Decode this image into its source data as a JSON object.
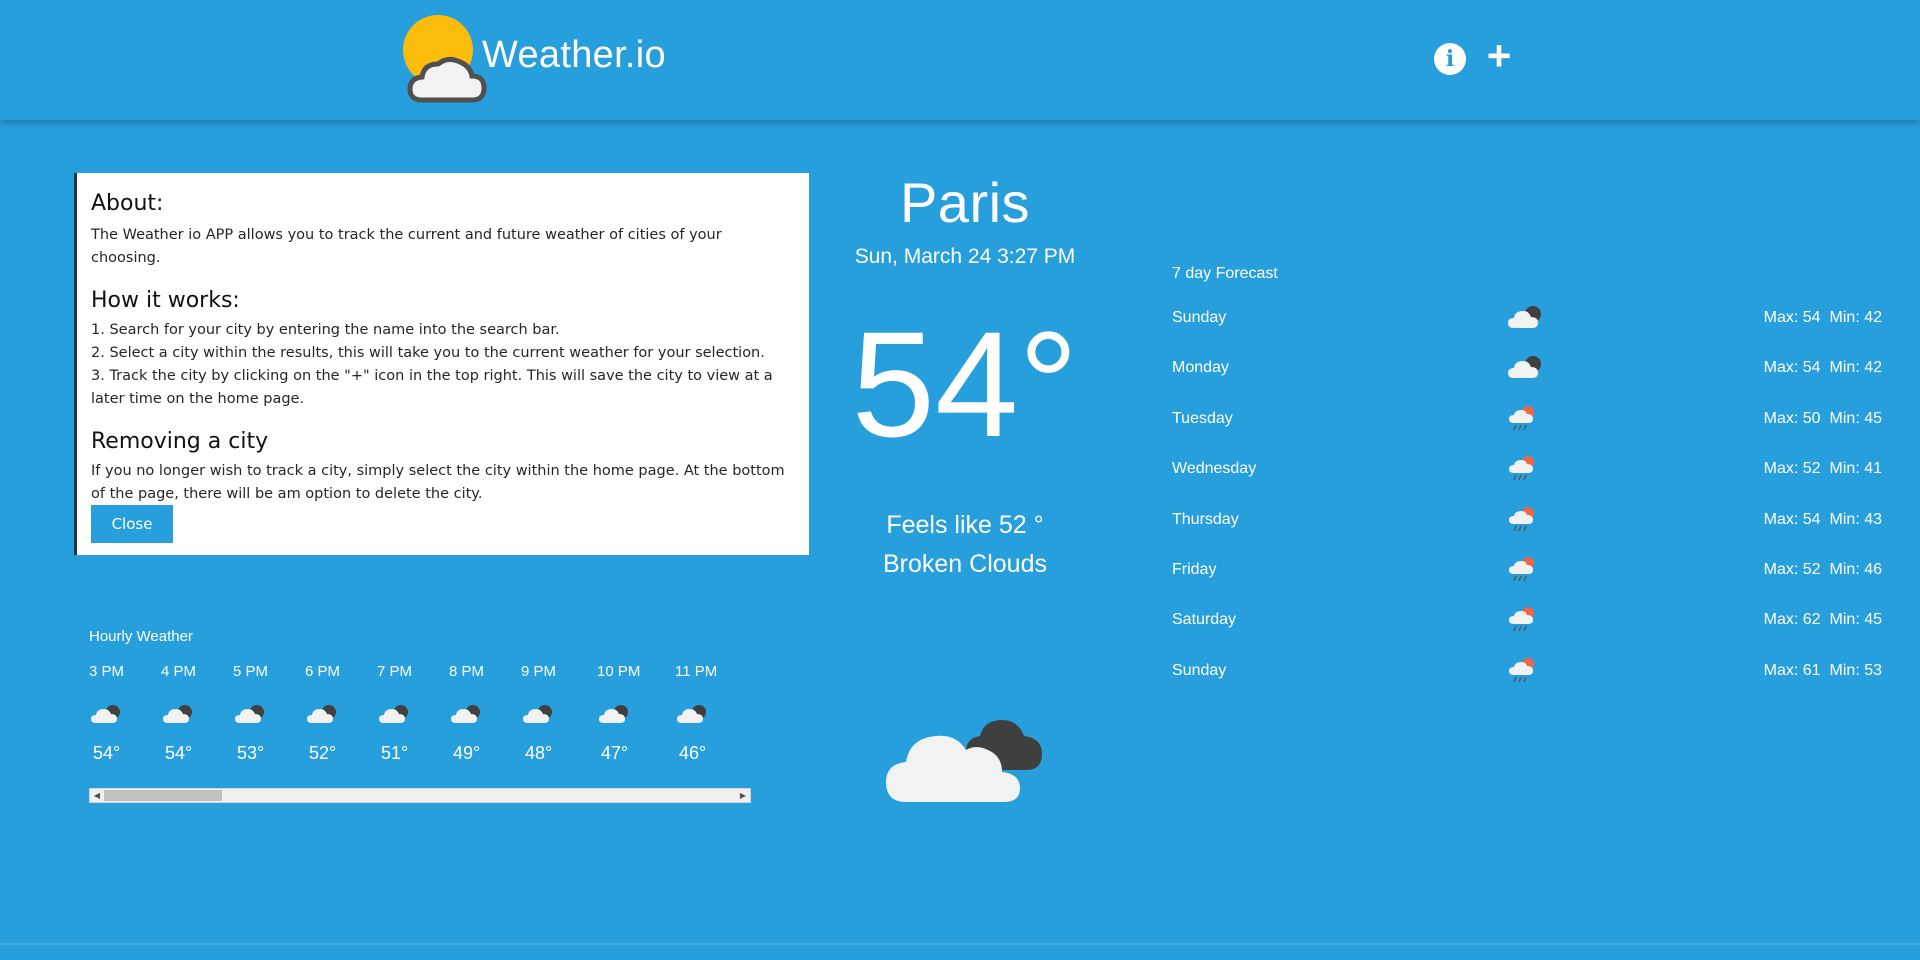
{
  "header": {
    "app_name": "Weather.io",
    "info_icon": "info-circle-icon",
    "add_icon": "plus-icon"
  },
  "about": {
    "heading": "About:",
    "description": "The Weather io APP allows you to track the current and future weather of cities of your choosing.",
    "how_heading": "How it works:",
    "steps": [
      "1. Search for your city by entering the name into the search bar.",
      "2. Select a city within the results, this will take you to the current weather for your selection.",
      "3. Track the city by clicking on the \"+\" icon in the top right. This will save the city to view at a later time on the home page."
    ],
    "remove_heading": "Removing a city",
    "remove_text": "If you no longer wish to track a city, simply select the city within the home page. At the bottom of the page, there will be am option to delete the city.",
    "close_label": "Close"
  },
  "current": {
    "city": "Paris",
    "datetime": "Sun, March 24 3:27 PM",
    "temperature": "54°",
    "feels_like": "Feels like 52 °",
    "description": "Broken Clouds",
    "icon": "broken-clouds-icon"
  },
  "hourly": {
    "title": "Hourly Weather",
    "hours": [
      {
        "time": "3 PM",
        "temp": "54°"
      },
      {
        "time": "4 PM",
        "temp": "54°"
      },
      {
        "time": "5 PM",
        "temp": "53°"
      },
      {
        "time": "6 PM",
        "temp": "52°"
      },
      {
        "time": "7 PM",
        "temp": "51°"
      },
      {
        "time": "8 PM",
        "temp": "49°"
      },
      {
        "time": "9 PM",
        "temp": "48°"
      },
      {
        "time": "10 PM",
        "temp": "47°"
      },
      {
        "time": "11 PM",
        "temp": "46°"
      }
    ]
  },
  "forecast": {
    "title": "7 day Forecast",
    "days": [
      {
        "day": "Sunday",
        "max": "Max: 54",
        "min": "Min: 42",
        "icon": "broken-clouds-icon"
      },
      {
        "day": "Monday",
        "max": "Max: 54",
        "min": "Min: 42",
        "icon": "broken-clouds-icon"
      },
      {
        "day": "Tuesday",
        "max": "Max: 50",
        "min": "Min: 45",
        "icon": "rain-icon"
      },
      {
        "day": "Wednesday",
        "max": "Max: 52",
        "min": "Min: 41",
        "icon": "rain-icon"
      },
      {
        "day": "Thursday",
        "max": "Max: 54",
        "min": "Min: 43",
        "icon": "rain-icon"
      },
      {
        "day": "Friday",
        "max": "Max: 52",
        "min": "Min: 46",
        "icon": "rain-icon"
      },
      {
        "day": "Saturday",
        "max": "Max: 62",
        "min": "Min: 45",
        "icon": "rain-icon"
      },
      {
        "day": "Sunday",
        "max": "Max: 61",
        "min": "Min: 53",
        "icon": "rain-icon"
      }
    ]
  },
  "colors": {
    "background": "#279fdc",
    "sun": "#fcbc0c",
    "cloud": "#f2f2f2",
    "dark_cloud": "#3f3f3f",
    "rain_sun": "#f0654a"
  }
}
